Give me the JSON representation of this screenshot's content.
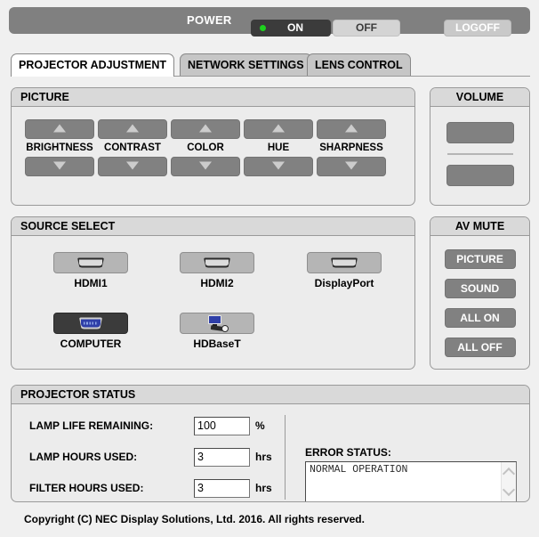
{
  "power_bar": {
    "label": "POWER",
    "on_label": "ON",
    "off_label": "OFF",
    "logoff_label": "LOGOFF",
    "led_color": "#1ed21e",
    "on_active": true
  },
  "tabs": [
    {
      "label": "PROJECTOR ADJUSTMENT",
      "active": true
    },
    {
      "label": "NETWORK SETTINGS",
      "active": false
    },
    {
      "label": "LENS CONTROL",
      "active": false
    }
  ],
  "picture": {
    "title": "PICTURE",
    "controls": [
      {
        "label": "BRIGHTNESS",
        "up": "up-arrow-icon",
        "down": "down-arrow-icon"
      },
      {
        "label": "CONTRAST",
        "up": "up-arrow-icon",
        "down": "down-arrow-icon"
      },
      {
        "label": "COLOR",
        "up": "up-arrow-icon",
        "down": "down-arrow-icon"
      },
      {
        "label": "HUE",
        "up": "up-arrow-icon",
        "down": "down-arrow-icon"
      },
      {
        "label": "SHARPNESS",
        "up": "up-arrow-icon",
        "down": "down-arrow-icon"
      }
    ]
  },
  "volume": {
    "title": "VOLUME",
    "up": "up-arrow-icon",
    "down": "down-arrow-icon"
  },
  "source_select": {
    "title": "SOURCE SELECT",
    "sources": [
      {
        "label": "HDMI1",
        "icon": "hdmi-connector-icon",
        "selected": false
      },
      {
        "label": "HDMI2",
        "icon": "hdmi-connector-icon",
        "selected": false
      },
      {
        "label": "DisplayPort",
        "icon": "displayport-connector-icon",
        "selected": false
      },
      {
        "label": "COMPUTER",
        "icon": "vga-connector-icon",
        "selected": true
      },
      {
        "label": "HDBaseT",
        "icon": "hdbaset-icon",
        "selected": false
      }
    ]
  },
  "av_mute": {
    "title": "AV MUTE",
    "buttons": [
      {
        "label": "PICTURE"
      },
      {
        "label": "SOUND"
      },
      {
        "label": "ALL ON"
      },
      {
        "label": "ALL OFF"
      }
    ]
  },
  "projector_status": {
    "title": "PROJECTOR STATUS",
    "rows": [
      {
        "label": "LAMP LIFE REMAINING:",
        "value": "100",
        "unit": "%"
      },
      {
        "label": "LAMP HOURS USED:",
        "value": "3",
        "unit": "hrs"
      },
      {
        "label": "FILTER HOURS USED:",
        "value": "3",
        "unit": "hrs"
      }
    ],
    "error_status_title": "ERROR STATUS:",
    "error_status_text": "NORMAL OPERATION"
  },
  "footer": {
    "copyright": "Copyright (C) NEC Display Solutions, Ltd. 2016. All rights reserved."
  }
}
